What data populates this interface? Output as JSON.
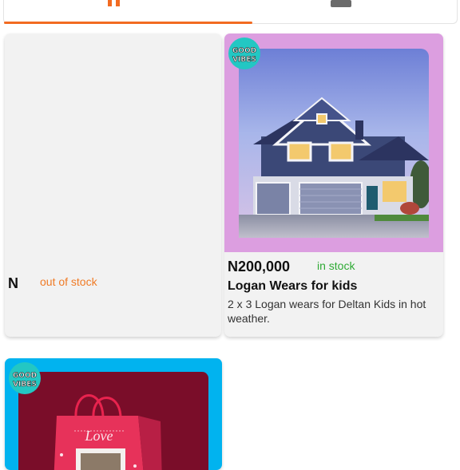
{
  "tabs": {
    "products": {
      "icon": "shop-icon",
      "active": true
    },
    "messages": {
      "icon": "chat-icon",
      "active": false
    }
  },
  "colors": {
    "accent": "#f26b21",
    "out_of_stock": "#f07b26",
    "in_stock": "#2eaa34"
  },
  "products": [
    {
      "price": "N",
      "stock_status": "out of stock",
      "has_image": false
    },
    {
      "price": "N200,000",
      "stock_status": "in stock",
      "title": "Logan Wears for kids",
      "description": "2 x 3 Logan wears for Deltan Kids in hot weather.",
      "badge": "GOOD VIBES",
      "image": "house-photo"
    },
    {
      "badge": "GOOD VIBES",
      "image": "gift-bag-photo",
      "bag_text": "Love"
    }
  ]
}
